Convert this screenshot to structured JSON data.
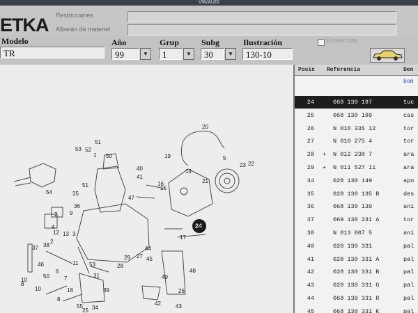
{
  "window": {
    "title": "VW/AUDI"
  },
  "app": {
    "logo": "ETKA"
  },
  "top": {
    "restricciones_label": "Restricciones",
    "albaran_label": "Albarán de materiel"
  },
  "selectors": {
    "modelo": {
      "label": "Modelo",
      "value": "TR"
    },
    "ano": {
      "label": "Año",
      "value": "99"
    },
    "grup": {
      "label": "Grup",
      "value": "1"
    },
    "subg": {
      "label": "Subg",
      "value": "30"
    },
    "ilustracion": {
      "label": "Ilustración",
      "value": "130-10"
    }
  },
  "existencias": {
    "label": "Existencias"
  },
  "icons": {
    "car": "car-icon",
    "dropdown": "chevron-down-icon"
  },
  "illustration": {
    "labels": [
      "20",
      "19",
      "51",
      "53",
      "52",
      "1",
      "50",
      "40",
      "14",
      "5",
      "23",
      "22",
      "21",
      "41",
      "16",
      "15",
      "54",
      "35",
      "47",
      "36",
      "51",
      "9",
      "2",
      "4",
      "12",
      "13",
      "3",
      "2",
      "24",
      "17",
      "37",
      "38",
      "46",
      "11",
      "44",
      "45",
      "27",
      "48",
      "10",
      "50",
      "7",
      "8",
      "10",
      "53",
      "28",
      "29",
      "6",
      "8",
      "55",
      "25",
      "34",
      "42",
      "43",
      "31",
      "39",
      "49",
      "26",
      "18"
    ],
    "callout": "24"
  },
  "parts_list": {
    "headers": {
      "posic": "Posic",
      "referencia": "Referencia",
      "denom": "Den"
    },
    "subheader": "bom",
    "rows": [
      {
        "pos": "24",
        "mark": "",
        "ref": "068 130 197",
        "desc": "tuc",
        "selected": true
      },
      {
        "pos": "25",
        "mark": "",
        "ref": "068 130 199",
        "desc": "cas",
        "selected": false
      },
      {
        "pos": "26",
        "mark": "",
        "ref": "N   010 335 12",
        "desc": "tor",
        "selected": false
      },
      {
        "pos": "27",
        "mark": "",
        "ref": "N   010 275 4",
        "desc": "tor",
        "selected": false
      },
      {
        "pos": "28",
        "mark": "+",
        "ref": "N   012 230 7",
        "desc": "ara",
        "selected": false
      },
      {
        "pos": "29",
        "mark": "+",
        "ref": "N   011 527 11",
        "desc": "ara",
        "selected": false
      },
      {
        "pos": "34",
        "mark": "",
        "ref": "028 130 149",
        "desc": "apo",
        "selected": false
      },
      {
        "pos": "35",
        "mark": "",
        "ref": "028 130 135 B",
        "desc": "des",
        "selected": false
      },
      {
        "pos": "36",
        "mark": "",
        "ref": "068 130 139",
        "desc": "ani",
        "selected": false
      },
      {
        "pos": "37",
        "mark": "",
        "ref": "069 130 231 A",
        "desc": "tor",
        "selected": false
      },
      {
        "pos": "38",
        "mark": "",
        "ref": "N   013 807 5",
        "desc": "ani",
        "selected": false
      },
      {
        "pos": "40",
        "mark": "",
        "ref": "028 130 331",
        "desc": "pal",
        "selected": false
      },
      {
        "pos": "41",
        "mark": "",
        "ref": "028 130 331 A",
        "desc": "pal",
        "selected": false
      },
      {
        "pos": "42",
        "mark": "",
        "ref": "028 130 331 B",
        "desc": "pal",
        "selected": false
      },
      {
        "pos": "43",
        "mark": "",
        "ref": "028 130 331 G",
        "desc": "pal",
        "selected": false
      },
      {
        "pos": "44",
        "mark": "",
        "ref": "068 130 331 R",
        "desc": "pal",
        "selected": false
      },
      {
        "pos": "45",
        "mark": "",
        "ref": "068 130 331 K",
        "desc": "pal",
        "selected": false
      }
    ]
  }
}
